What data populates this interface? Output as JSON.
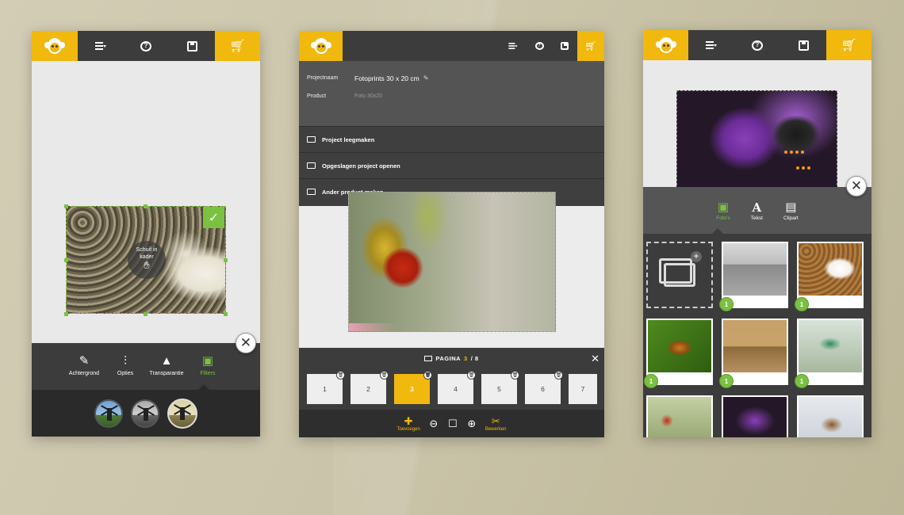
{
  "panel1": {
    "drag_hint": [
      "Schuif in",
      "kader"
    ],
    "tools": [
      {
        "label": "Achtergrond",
        "icon": "brush-icon",
        "active": false
      },
      {
        "label": "Opties",
        "icon": "sliders-icon",
        "active": false
      },
      {
        "label": "Transparantie",
        "icon": "drop-icon",
        "active": false
      },
      {
        "label": "Filters",
        "icon": "image-filter-icon",
        "active": true
      }
    ],
    "filters": [
      {
        "name": "color",
        "active": false
      },
      {
        "name": "grayscale",
        "active": false
      },
      {
        "name": "sepia",
        "active": true
      }
    ]
  },
  "panel2": {
    "project_name_label": "Projectnaam",
    "project_name_value": "Fotoprints 30 x 20 cm",
    "product_label": "Product",
    "product_value": "Foto 30x20",
    "menu_items": [
      "Project leegmaken",
      "Opgeslagen project openen",
      "Ander product maken"
    ],
    "page_label": "PAGINA",
    "page_current": "3",
    "page_total": "/ 8",
    "pages": [
      "1",
      "2",
      "3",
      "4",
      "5",
      "6",
      "7"
    ],
    "active_page": "3",
    "edit_tools": [
      {
        "label": "Toevoegen",
        "icon": "plus-icon"
      },
      {
        "label": "",
        "icon": "zoom-out-icon"
      },
      {
        "label": "",
        "icon": "fit-frame-icon"
      },
      {
        "label": "",
        "icon": "zoom-in-icon"
      },
      {
        "label": "Bewerken",
        "icon": "tools-icon"
      }
    ]
  },
  "panel3": {
    "tabs": [
      {
        "label": "Foto's",
        "icon": "photos-icon",
        "active": true
      },
      {
        "label": "Tekst",
        "icon": "text-icon",
        "active": false
      },
      {
        "label": "Clipart",
        "icon": "clipart-icon",
        "active": false
      }
    ],
    "grid": [
      {
        "type": "add"
      },
      {
        "pic": "pic-seals",
        "count": "1"
      },
      {
        "pic": "pic-cat",
        "count": "1"
      },
      {
        "pic": "pic-butterfly2",
        "count": "1"
      },
      {
        "pic": "pic-lions",
        "count": "1"
      },
      {
        "pic": "pic-bird",
        "count": "1"
      },
      {
        "pic": "pic-ladybug",
        "count": ""
      },
      {
        "pic": "pic-purple",
        "count": ""
      },
      {
        "pic": "pic-deer",
        "count": ""
      }
    ]
  },
  "colors": {
    "accent": "#f1b80d",
    "success": "#7ac142",
    "bar": "#3c3c3c"
  }
}
